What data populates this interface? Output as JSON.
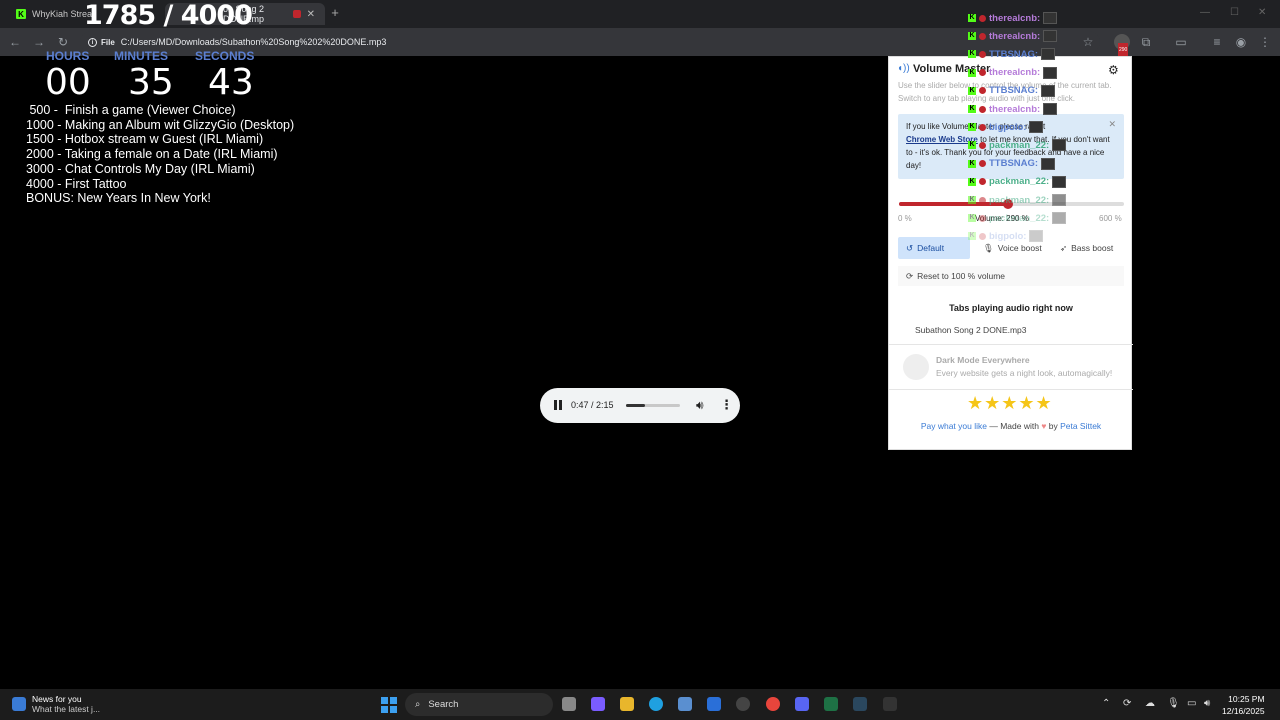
{
  "browser": {
    "tabs": [
      {
        "title": "WhyKiah Strea"
      },
      {
        "title": "on Song 2 DONE.mp"
      }
    ],
    "address": {
      "chip_label": "File",
      "url": "C:/Users/MD/Downloads/Subathon%20Song%202%20DONE.mp3"
    },
    "extension_badge": "290"
  },
  "overlay": {
    "goal_counter": "1785 / 4000",
    "timer": {
      "labels": {
        "hours": "HOURS",
        "minutes": "MINUTES",
        "seconds": "SECONDS"
      },
      "values": {
        "hours": "00",
        "minutes": "35",
        "seconds": "43"
      }
    },
    "goals": [
      " 500 -  Finish a game (Viewer Choice)",
      "1000 - Making an Album wit GlizzyGio (Desktop)",
      "1500 - Hotbox stream w Guest (IRL Miami)",
      "2000 - Taking a female on a Date (IRL Miami)",
      "3000 - Chat Controls My Day (IRL Miami)",
      "4000 - First Tattoo",
      "BONUS: New Years In New York!"
    ],
    "chat": [
      {
        "user": "therealcnb:",
        "color": "#b57bd9"
      },
      {
        "user": "therealcnb:",
        "color": "#b57bd9"
      },
      {
        "user": "TTBSNAG:",
        "color": "#5b7fd0"
      },
      {
        "user": "therealcnb:",
        "color": "#b57bd9"
      },
      {
        "user": "TTBSNAG:",
        "color": "#5b7fd0"
      },
      {
        "user": "therealcnb:",
        "color": "#b57bd9"
      },
      {
        "user": "bigpolo:",
        "color": "#5b7fd0"
      },
      {
        "user": "packman_22:",
        "color": "#4caf8a"
      },
      {
        "user": "TTBSNAG:",
        "color": "#5b7fd0"
      },
      {
        "user": "packman_22:",
        "color": "#4caf8a"
      },
      {
        "user": "packman_22:",
        "color": "#4caf8a"
      },
      {
        "user": "packman_22:",
        "color": "#4caf8a"
      },
      {
        "user": "bigpolo:",
        "color": "#5b7fd0"
      }
    ]
  },
  "player": {
    "time": "0:47 / 2:15",
    "progress": 0.35
  },
  "volume_master": {
    "title": "Volume Master",
    "description": "Use the slider below to control the volume of the current tab. Switch to any tab playing audio with just one click.",
    "notice": {
      "line1": "If you like Volume Master, please rate it",
      "link": "Chrome Web Store",
      "line2": " to let me know that. If you don't want to - it's ok. Thank you for your feedback and have a nice day!"
    },
    "slider": {
      "min_label": "0 %",
      "max_label": "600 %",
      "value_label": "Volume: 290 %",
      "value": 290,
      "max": 600
    },
    "modes": {
      "default": "Default",
      "voice": "Voice boost",
      "bass": "Bass boost"
    },
    "reset_label": "Reset to 100 % volume",
    "tabs_heading": "Tabs playing audio right now",
    "tab_item": "Subathon Song 2 DONE.mp3",
    "promo": {
      "title": "Dark Mode Everywhere",
      "subtitle": "Every website gets a night look, automagically!"
    },
    "footer": {
      "pay": "Pay what you like",
      "made": " — Made with ",
      "by": " by ",
      "author": "Peta Sittek"
    }
  },
  "taskbar": {
    "news_title": "News for you",
    "news_sub": "What the latest j...",
    "search_label": "Search",
    "time": "10:25 PM",
    "date": "12/16/2025"
  }
}
